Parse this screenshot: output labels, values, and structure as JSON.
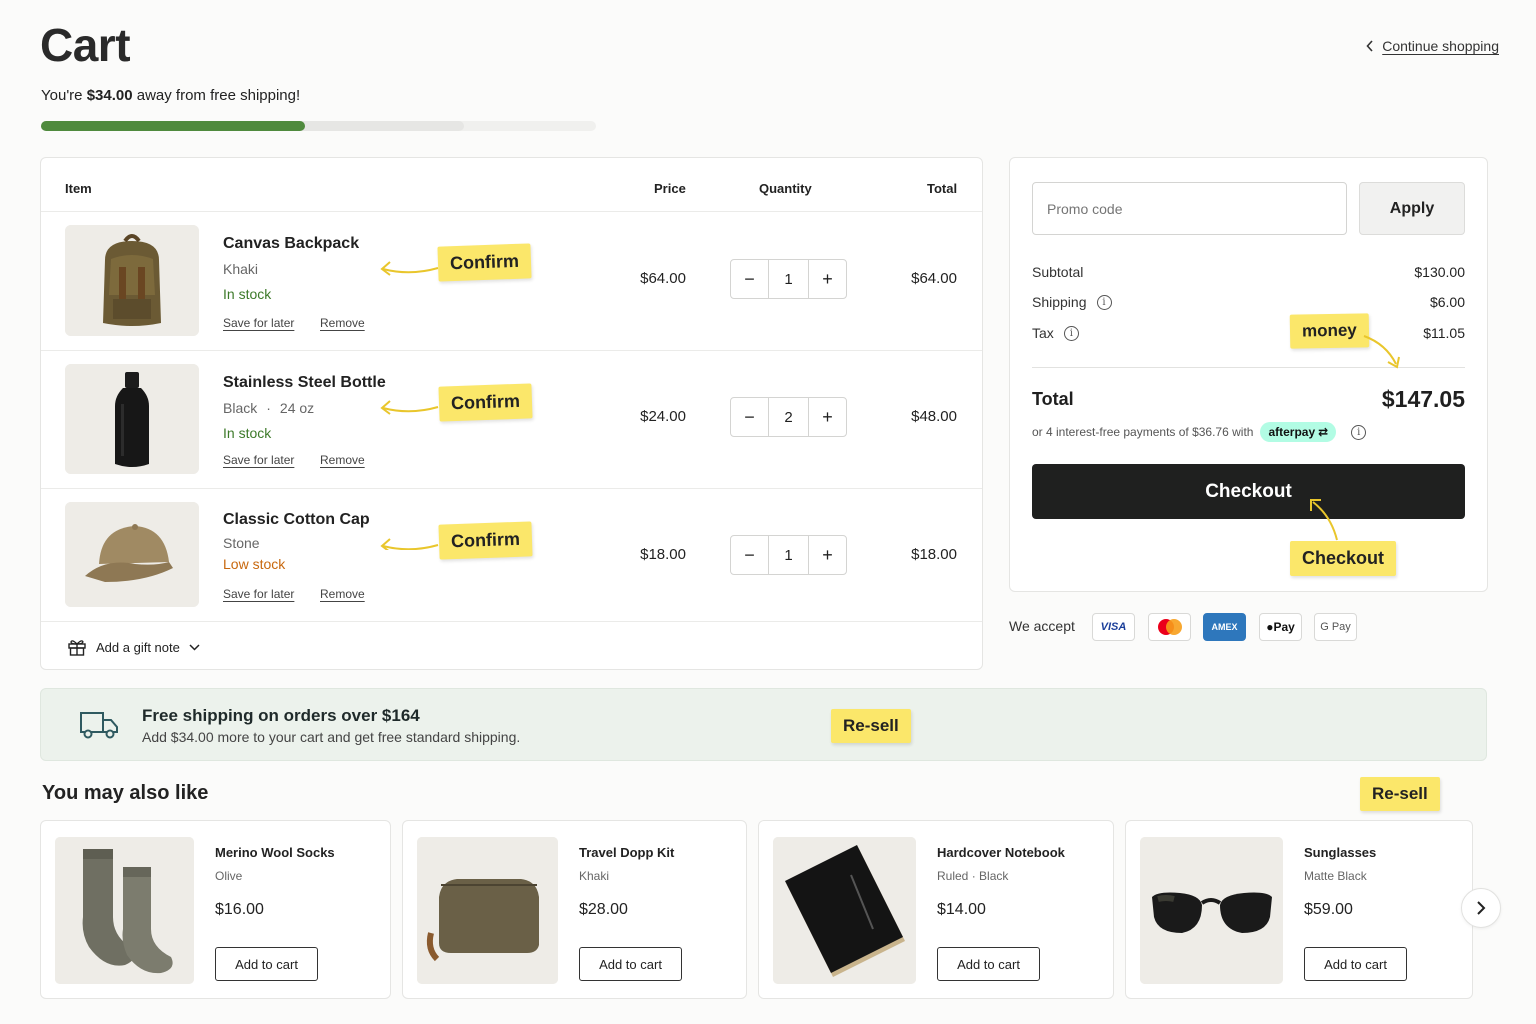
{
  "header": {
    "title": "Cart",
    "continue_label": "Continue shopping"
  },
  "free_shipping": {
    "prefix": "You're ",
    "amount": "$34.00",
    "suffix": " away from free shipping!",
    "progress_fraction": 0.475
  },
  "table": {
    "headers": {
      "item": "Item",
      "price": "Price",
      "quantity": "Quantity",
      "total": "Total"
    },
    "items": [
      {
        "name": "Canvas Backpack",
        "variant": "Khaki",
        "variant2": "",
        "stock": "In stock",
        "stock_status": "in",
        "price": "$64.00",
        "qty": "1",
        "total": "$64.00",
        "save_label": "Save for later",
        "remove_label": "Remove",
        "note": "Confirm"
      },
      {
        "name": "Stainless Steel Bottle",
        "variant": "Black",
        "variant2": "24 oz",
        "stock": "In stock",
        "stock_status": "in",
        "price": "$24.00",
        "qty": "2",
        "total": "$48.00",
        "save_label": "Save for later",
        "remove_label": "Remove",
        "note": "Confirm"
      },
      {
        "name": "Classic Cotton Cap",
        "variant": "Stone",
        "variant2": "",
        "stock": "Low stock",
        "stock_status": "low",
        "price": "$18.00",
        "qty": "1",
        "total": "$18.00",
        "save_label": "Save for later",
        "remove_label": "Remove",
        "note": "Confirm"
      }
    ],
    "qty_minus": "−",
    "qty_plus": "+",
    "gift_note_label": "Add a gift note"
  },
  "summary": {
    "promo_placeholder": "Promo code",
    "apply_label": "Apply",
    "subtotal_label": "Subtotal",
    "subtotal_value": "$130.00",
    "shipping_label": "Shipping",
    "shipping_value": "$6.00",
    "tax_label": "Tax",
    "tax_value": "$11.05",
    "total_label": "Total",
    "total_value": "$147.05",
    "installments_text": "or 4 interest-free payments of $36.76 with",
    "afterpay_label": "afterpay",
    "checkout_label": "Checkout",
    "money_note": "money",
    "checkout_note": "Checkout"
  },
  "payments": {
    "label": "We accept",
    "methods": [
      "VISA",
      "AMEX",
      "Pay",
      "G Pay"
    ]
  },
  "ship_banner": {
    "title": "Free shipping on orders over $164",
    "subtitle": "Add $34.00 more to your cart and get free standard shipping.",
    "note": "Re-sell"
  },
  "recommendations": {
    "title": "You may also like",
    "note": "Re-sell",
    "add_label": "Add to cart",
    "items": [
      {
        "name": "Merino Wool Socks",
        "variant": "Olive",
        "price": "$16.00"
      },
      {
        "name": "Travel Dopp Kit",
        "variant": "Khaki",
        "price": "$28.00"
      },
      {
        "name": "Hardcover Notebook",
        "variant": "Ruled · Black",
        "price": "$14.00"
      },
      {
        "name": "Sunglasses",
        "variant": "Matte Black",
        "price": "$59.00"
      }
    ]
  },
  "colors": {
    "progress": "#4f8a3d",
    "in_stock": "#3d7a2a",
    "low_stock": "#c8680e",
    "sticky_note": "#fbe76a",
    "checkout_bg": "#1f201f",
    "banner_bg": "#ecf2ec",
    "afterpay_bg": "#b2fce4"
  },
  "icons": [
    "chevron-left-icon",
    "gift-icon",
    "chevron-down-icon",
    "info-icon",
    "truck-icon",
    "chevron-right-icon",
    "arrow-icon"
  ]
}
